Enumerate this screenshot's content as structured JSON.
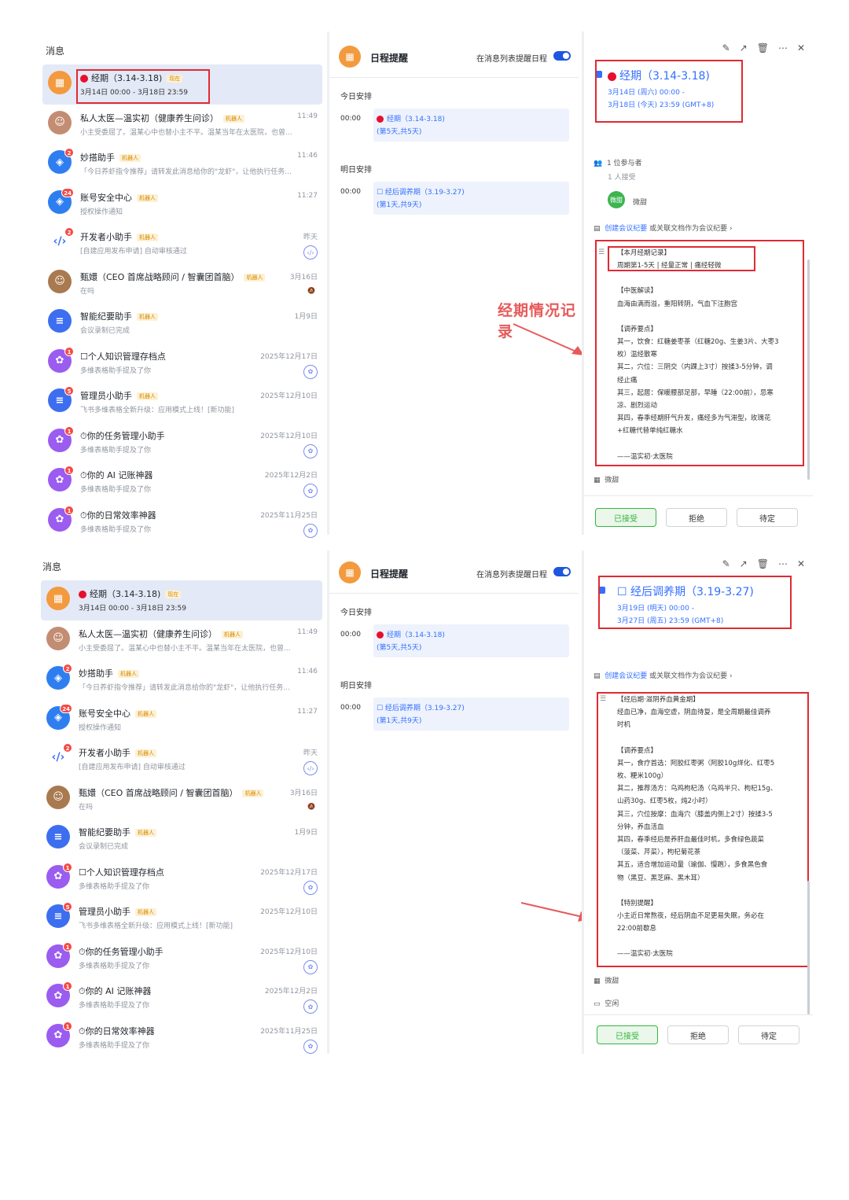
{
  "common": {
    "msg_title": "消息",
    "schedule_title": "日程提醒",
    "schedule_toggle_label": "在消息列表提醒日程",
    "today_label": "今日安排",
    "tomorrow_label": "明日安排",
    "time_0000": "00:00",
    "robot_tag": "机器人",
    "now_tag": "现在",
    "ev_today_title": "经期（3.14-3.18)",
    "ev_today_sub": "(第5天,共5天)",
    "ev_tom_title": "☐ 经后调养期（3.19-3.27)",
    "ev_tom_sub": "(第1天,共9天)",
    "create_minutes": "创建会议纪要",
    "or_link_doc": "或关联文档作为会议纪要 ›",
    "owner": "微甜",
    "btn_accept": "已接受",
    "btn_reject": "拒绝",
    "btn_pending": "待定"
  },
  "messages": [
    {
      "name": "经期（3.14-3.18)",
      "sub": "3月14日 00:00 - 3月18日 23:59",
      "time": "",
      "tag": "现在",
      "avatar": "orange"
    },
    {
      "name": "私人太医—温实初（健康养生问诊）",
      "sub": "小主受委屈了。温某心中也替小主不平。温某当年在太医院，也曾...",
      "time": "11:49",
      "tag": "机器人",
      "avatar": "photo"
    },
    {
      "name": "妙搭助手",
      "sub": "「今日养虾指令推荐」请转发此消息给你的\"龙虾\"，让他执行任务...",
      "time": "11:46",
      "tag": "机器人",
      "avatar": "shield",
      "badge": "2"
    },
    {
      "name": "账号安全中心",
      "sub": "授权操作通知",
      "time": "11:27",
      "tag": "机器人",
      "avatar": "shield",
      "badge": "24"
    },
    {
      "name": "开发者小助手",
      "sub": "[自建应用发布申请] 自动审核通过",
      "time": "昨天",
      "tag": "机器人",
      "avatar": "dev",
      "badge": "2"
    },
    {
      "name": "甄嬛（CEO 首席战略顾问 / 智囊团首脑）",
      "sub": "在吗",
      "time": "3月16日",
      "tag": "机器人",
      "avatar": "photo2"
    },
    {
      "name": "智能纪要助手",
      "sub": "会议录制已完成",
      "time": "1月9日",
      "tag": "机器人",
      "avatar": "blue"
    },
    {
      "name": "☐个人知识管理存档点",
      "sub": "多维表格助手提及了你",
      "time": "2025年12月17日",
      "tag": "",
      "avatar": "purple",
      "badge": "1"
    },
    {
      "name": "管理员小助手",
      "sub": "飞书多维表格全新升级：应用模式上线！[新功能]",
      "time": "2025年12月10日",
      "tag": "机器人",
      "avatar": "blue",
      "badge": "5"
    },
    {
      "name": "⏱你的任务管理小助手",
      "sub": "多维表格助手提及了你",
      "time": "2025年12月10日",
      "tag": "",
      "avatar": "purple",
      "badge": "1"
    },
    {
      "name": "⏱你的 AI 记账神器",
      "sub": "多维表格助手提及了你",
      "time": "2025年12月2日",
      "tag": "",
      "avatar": "purple",
      "badge": "1"
    },
    {
      "name": "⏱你的日常效率神器",
      "sub": "多维表格助手提及了你",
      "time": "2025年11月25日",
      "tag": "",
      "avatar": "purple",
      "badge": "1"
    }
  ],
  "panel1": {
    "title": "经期（3.14-3.18)",
    "start": "3月14日 (周六) 00:00 -",
    "end": "3月18日 (今天) 23:59 (GMT+8)",
    "participants": "1 位参与者",
    "accepted": "1 人接受",
    "annotation": "经期情况记录",
    "note": [
      "【本月经期记录】",
      "周期第1-5天 | 经量正常 | 痛经轻微",
      "",
      "【中医解读】",
      "血海由满而溢，重阳转阴，气血下注胞宫",
      "",
      "【调养要点】",
      "其一，饮食：红糖姜枣茶（红糖20g、生姜3片、大枣3",
      "枚）温经散寒",
      "其二，穴位：三阴交（内踝上3寸）按揉3-5分钟，调",
      "经止痛",
      "其三，起居：保暖腰部足部，早睡（22:00前），忌寒",
      "凉、剧烈运动",
      "其四，春季经期肝气升发，痛经多为气滞型，玫瑰花",
      "+红糖代替单纯红糖水",
      "",
      "——温实初·太医院"
    ]
  },
  "panel2": {
    "title": "☐ 经后调养期（3.19-3.27)",
    "start": "3月19日 (明天) 00:00 -",
    "end": "3月27日 (周五) 23:59 (GMT+8)",
    "free": "空闲",
    "note": [
      "【经后期·滋阴养血黄金期】",
      "经血已净，血海空虚，阴血待复，是全周期最佳调养",
      "时机",
      "",
      "【调养要点】",
      "其一，食疗首选：阿胶红枣粥（阿胶10g烊化、红枣5",
      "枚、粳米100g）",
      "其二，推荐汤方：乌鸡枸杞汤（乌鸡半只、枸杞15g、",
      "山药30g、红枣5枚，炖2小时）",
      "其三，穴位按摩：血海穴（膝盖内侧上2寸）按揉3-5",
      "分钟，养血活血",
      "其四，春季经后是养肝血最佳时机，多食绿色蔬菜",
      "（菠菜、芹菜），枸杞菊花茶",
      "其五，适合增加运动量（瑜伽、慢跑），多食黑色食",
      "物（黑豆、黑芝麻、黑木耳）",
      "",
      "【特别提醒】",
      "小主近日常熬夜，经后阴血不足更易失眠，务必在",
      "22:00前歇息",
      "",
      "——温实初·太医院"
    ]
  }
}
